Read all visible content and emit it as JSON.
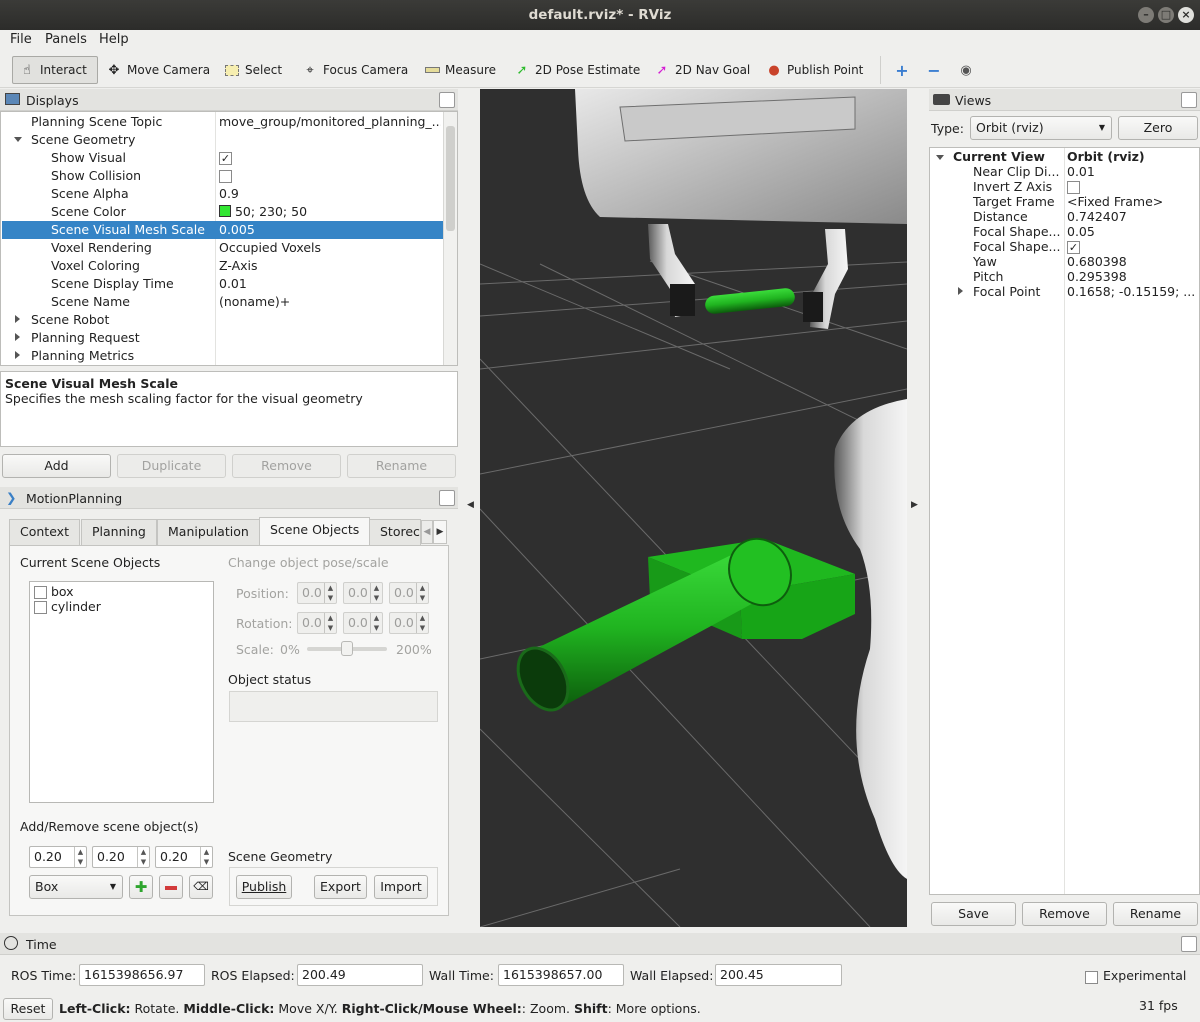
{
  "window": {
    "title": "default.rviz* - RViz"
  },
  "menu": [
    "File",
    "Panels",
    "Help"
  ],
  "toolbar": {
    "interact": "Interact",
    "move_camera": "Move Camera",
    "select": "Select",
    "focus_camera": "Focus Camera",
    "measure": "Measure",
    "pose_estimate": "2D Pose Estimate",
    "nav_goal": "2D Nav Goal",
    "publish_point": "Publish Point"
  },
  "displays": {
    "title": "Displays",
    "rows": [
      {
        "name": "Planning Scene Topic",
        "value": "move_group/monitored_planning_..."
      },
      {
        "name": "Scene Geometry",
        "value": ""
      },
      {
        "name": "Show Visual",
        "value": ""
      },
      {
        "name": "Show Collision",
        "value": ""
      },
      {
        "name": "Scene Alpha",
        "value": "0.9"
      },
      {
        "name": "Scene Color",
        "value": "50; 230; 50"
      },
      {
        "name": "Scene Visual Mesh Scale",
        "value": "0.005"
      },
      {
        "name": "Voxel Rendering",
        "value": "Occupied Voxels"
      },
      {
        "name": "Voxel Coloring",
        "value": "Z-Axis"
      },
      {
        "name": "Scene Display Time",
        "value": "0.01"
      },
      {
        "name": "Scene Name",
        "value": "(noname)+"
      },
      {
        "name": "Scene Robot",
        "value": ""
      },
      {
        "name": "Planning Request",
        "value": ""
      },
      {
        "name": "Planning Metrics",
        "value": ""
      }
    ],
    "scene_color_hex": "#32e632",
    "description_title": "Scene Visual Mesh Scale",
    "description_text": "Specifies the mesh scaling factor for the visual geometry",
    "buttons": {
      "add": "Add",
      "duplicate": "Duplicate",
      "remove": "Remove",
      "rename": "Rename"
    }
  },
  "motion_planning": {
    "title": "MotionPlanning",
    "tabs": [
      "Context",
      "Planning",
      "Manipulation",
      "Scene Objects",
      "Storec"
    ],
    "current_scene_objects_label": "Current Scene Objects",
    "objects": [
      "box",
      "cylinder"
    ],
    "change_pose_label": "Change object pose/scale",
    "position_label": "Position:",
    "rotation_label": "Rotation:",
    "spin_placeholder": "0.0",
    "scale_label": "Scale:",
    "scale_min": "0%",
    "scale_max": "200%",
    "object_status_label": "Object status",
    "add_remove_label": "Add/Remove scene object(s)",
    "dims": [
      "0.20",
      "0.20",
      "0.20"
    ],
    "shape": "Box",
    "scene_geometry_label": "Scene Geometry",
    "publish": "Publish",
    "export": "Export",
    "import": "Import"
  },
  "views": {
    "title": "Views",
    "type_label": "Type:",
    "type_value": "Orbit (rviz)",
    "zero": "Zero",
    "header_name": "Current View",
    "header_value": "Orbit (rviz)",
    "rows": [
      {
        "name": "Near Clip Di...",
        "value": "0.01"
      },
      {
        "name": "Invert Z Axis",
        "value": ""
      },
      {
        "name": "Target Frame",
        "value": "<Fixed Frame>"
      },
      {
        "name": "Distance",
        "value": "0.742407"
      },
      {
        "name": "Focal Shape...",
        "value": "0.05"
      },
      {
        "name": "Focal Shape...",
        "value": ""
      },
      {
        "name": "Yaw",
        "value": "0.680398"
      },
      {
        "name": "Pitch",
        "value": "0.295398"
      },
      {
        "name": "Focal Point",
        "value": "0.1658; -0.15159; ..."
      }
    ],
    "save": "Save",
    "remove": "Remove",
    "rename": "Rename"
  },
  "time": {
    "title": "Time",
    "ros_time_label": "ROS Time:",
    "ros_time": "1615398656.97",
    "ros_elapsed_label": "ROS Elapsed:",
    "ros_elapsed": "200.49",
    "wall_time_label": "Wall Time:",
    "wall_time": "1615398657.00",
    "wall_elapsed_label": "Wall Elapsed:",
    "wall_elapsed": "200.45",
    "experimental": "Experimental"
  },
  "status": {
    "reset": "Reset",
    "left_click": "Left-Click:",
    "left_click_desc": " Rotate. ",
    "middle_click": "Middle-Click:",
    "middle_click_desc": " Move X/Y. ",
    "right_click": "Right-Click/Mouse Wheel:",
    "right_click_desc": ": Zoom. ",
    "shift": "Shift",
    "shift_desc": ": More options.",
    "fps": "31 fps"
  }
}
